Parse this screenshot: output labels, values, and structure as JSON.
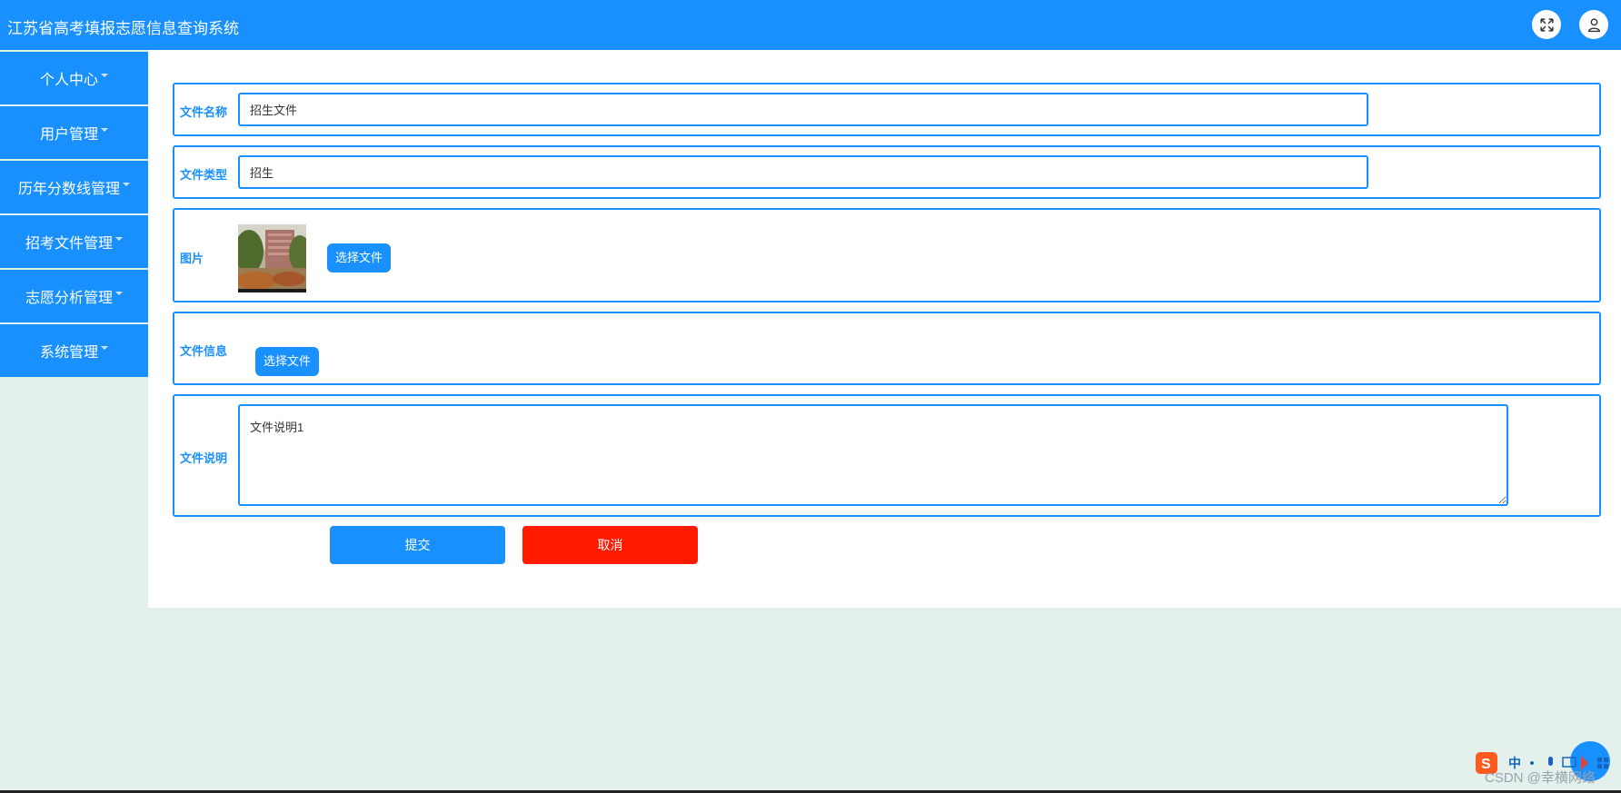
{
  "app": {
    "title": "江苏省高考填报志愿信息查询系统"
  },
  "header": {
    "fullscreen_icon": "expand-arrows-icon",
    "user_icon": "user-icon"
  },
  "sidebar": {
    "items": [
      {
        "label": "个人中心"
      },
      {
        "label": "用户管理"
      },
      {
        "label": "历年分数线管理"
      },
      {
        "label": "招考文件管理"
      },
      {
        "label": "志愿分析管理"
      },
      {
        "label": "系统管理"
      }
    ]
  },
  "form": {
    "file_name": {
      "label": "文件名称",
      "value": "招生文件"
    },
    "file_type": {
      "label": "文件类型",
      "value": "招生"
    },
    "image": {
      "label": "图片",
      "button": "选择文件"
    },
    "file_info": {
      "label": "文件信息",
      "button": "选择文件"
    },
    "description": {
      "label": "文件说明",
      "value": "文件说明1"
    },
    "submit_label": "提交",
    "cancel_label": "取消"
  },
  "overlay": {
    "watermark": "CSDN @幸横网络",
    "ime_text": "中"
  },
  "colors": {
    "primary": "#1890ff",
    "danger": "#ff1a00",
    "page_bg": "#e3f0ec"
  }
}
